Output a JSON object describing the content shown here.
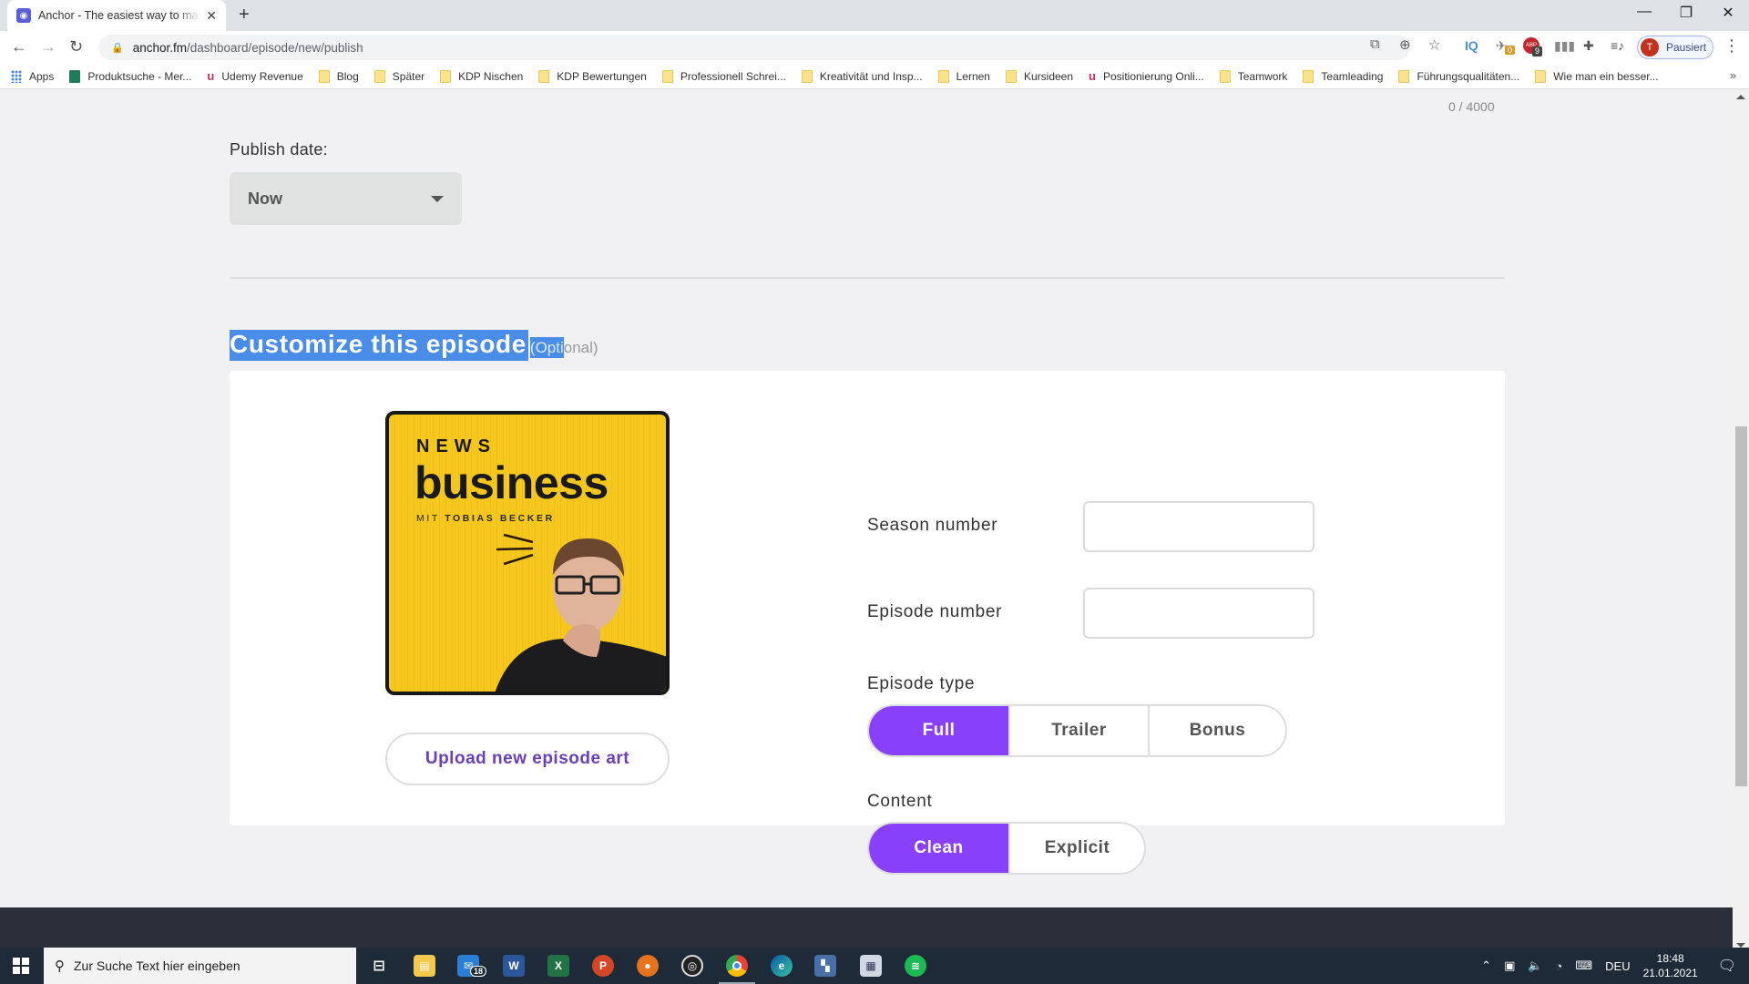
{
  "browser": {
    "tab": {
      "title": "Anchor - The easiest way to make a podcast",
      "favicon": "anchor-icon",
      "close": "✕"
    },
    "new_tab": "+",
    "window_controls": {
      "minimize": "—",
      "restore": "❐",
      "close": "✕"
    },
    "nav": {
      "back": "←",
      "forward": "→",
      "reload": "↻"
    },
    "url": {
      "host": "anchor.fm",
      "path": "/dashboard/episode/new/publish"
    },
    "extensions": {
      "iq_label": "IQ",
      "ext_badge_1": "0",
      "abp_label": "ABP",
      "abp_badge": "9"
    },
    "profile": {
      "initial": "T",
      "status": "Pausiert"
    },
    "bookmarks": [
      {
        "label": "Apps",
        "icon": "apps-icon"
      },
      {
        "label": "Produktsuche - Mer...",
        "icon": "shirt-icon"
      },
      {
        "label": "Udemy Revenue",
        "icon": "udemy-icon"
      },
      {
        "label": "Blog",
        "icon": "folder-icon"
      },
      {
        "label": "Später",
        "icon": "folder-icon"
      },
      {
        "label": "KDP Nischen",
        "icon": "folder-icon"
      },
      {
        "label": "KDP Bewertungen",
        "icon": "folder-icon"
      },
      {
        "label": "Professionell Schrei...",
        "icon": "folder-icon"
      },
      {
        "label": "Kreativität und Insp...",
        "icon": "folder-icon"
      },
      {
        "label": "Lernen",
        "icon": "folder-icon"
      },
      {
        "label": "Kursideen",
        "icon": "folder-icon"
      },
      {
        "label": "Positionierung Onli...",
        "icon": "udemy-icon"
      },
      {
        "label": "Teamwork",
        "icon": "folder-icon"
      },
      {
        "label": "Teamleading",
        "icon": "folder-icon"
      },
      {
        "label": "Führungsqualitäten...",
        "icon": "folder-icon"
      },
      {
        "label": "Wie man ein besser...",
        "icon": "folder-icon"
      }
    ],
    "bookmarks_more": "»"
  },
  "page": {
    "char_counter": "0 / 4000",
    "publish_date": {
      "label": "Publish date:",
      "selected": "Now"
    },
    "customize": {
      "title": "Customize this episode",
      "optional_selected": "(Opti",
      "optional_rest": "onal)"
    },
    "episode_art": {
      "line1": "NEWS",
      "line2": "business",
      "line3_prefix": "MIT ",
      "line3_name": "TOBIAS BECKER"
    },
    "upload_button": "Upload new episode art",
    "season_number": {
      "label": "Season number",
      "value": ""
    },
    "episode_number": {
      "label": "Episode number",
      "value": ""
    },
    "episode_type": {
      "label": "Episode type",
      "options": [
        "Full",
        "Trailer",
        "Bonus"
      ],
      "selected": "Full"
    },
    "content": {
      "label": "Content",
      "options": [
        "Clean",
        "Explicit"
      ],
      "selected": "Clean"
    },
    "accent_color": "#8940fa"
  },
  "taskbar": {
    "search_placeholder": "Zur Suche Text hier eingeben",
    "mail_badge": "18",
    "apps": [
      "task-view",
      "file-explorer",
      "mail",
      "word",
      "excel",
      "powerpoint",
      "app-orange",
      "obs",
      "chrome",
      "edge",
      "app-blue",
      "app-doc",
      "spotify"
    ],
    "language": "DEU",
    "time": "18:48",
    "date": "21.01.2021"
  }
}
